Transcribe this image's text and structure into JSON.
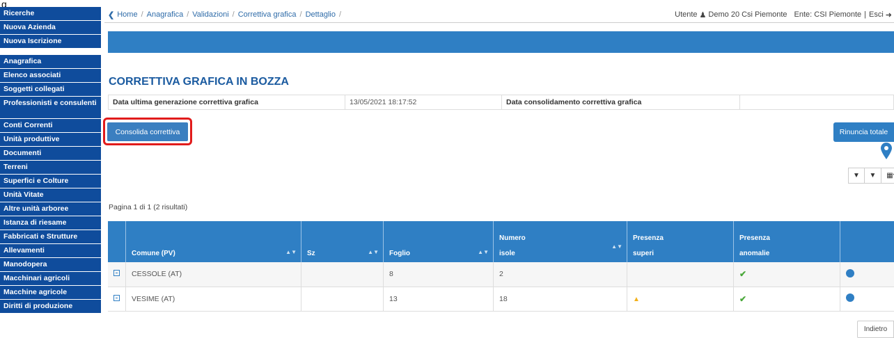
{
  "figure_label": "g",
  "sidebar": {
    "group1": [
      "Ricerche",
      "Nuova Azienda",
      "Nuova Iscrizione"
    ],
    "group2": [
      "Anagrafica",
      "Elenco associati",
      "Soggetti collegati",
      "Professionisti e consulenti",
      "Conti Correnti",
      "Unità produttive",
      "Documenti",
      "Terreni",
      "Superfici e Colture",
      "Unità Vitate",
      "Altre unità arboree",
      "Istanza di riesame",
      "Fabbricati e Strutture",
      "Allevamenti",
      "Manodopera",
      "Macchinari agricoli",
      "Macchine agricole",
      "Diritti di produzione"
    ]
  },
  "breadcrumb": [
    "Home",
    "Anagrafica",
    "Validazioni",
    "Correttiva grafica",
    "Dettaglio"
  ],
  "user": {
    "prefix": "Utente",
    "name": "Demo 20 Csi Piemonte",
    "ente": "Ente: CSI Piemonte",
    "logout": "Esci"
  },
  "page_title": "CORRETTIVA GRAFICA IN BOZZA",
  "info": {
    "gen_label": "Data ultima generazione correttiva grafica",
    "gen_value": "13/05/2021 18:17:52",
    "cons_label": "Data consolidamento correttiva grafica",
    "cons_value": ""
  },
  "buttons": {
    "consolida": "Consolida correttiva",
    "rinuncia": "Rinuncia totale",
    "indietro": "Indietro"
  },
  "toolbar_icons": [
    "chevron-down-icon",
    "filter-icon",
    "columns-icon"
  ],
  "pagination": "Pagina 1 di 1 (2 risultati)",
  "table": {
    "headers": [
      "",
      "Comune (PV)",
      "Sz",
      "Foglio",
      "Numero isole",
      "Presenza superi",
      "Presenza anomalie",
      ""
    ],
    "header_lines": {
      "numero": [
        "Numero",
        "isole"
      ],
      "superi": [
        "Presenza",
        "superi"
      ],
      "anomalie": [
        "Presenza",
        "anomalie"
      ]
    },
    "rows": [
      {
        "comune": "CESSOLE (AT)",
        "sz": "",
        "foglio": "8",
        "isole": "2",
        "superi": "",
        "anomalie": "check"
      },
      {
        "comune": "VESIME (AT)",
        "sz": "",
        "foglio": "13",
        "isole": "18",
        "superi": "warning",
        "anomalie": "check"
      }
    ]
  },
  "colors": {
    "sidebar": "#0f4c9c",
    "accent": "#2f7fc4",
    "highlight": "#e11b1b"
  }
}
